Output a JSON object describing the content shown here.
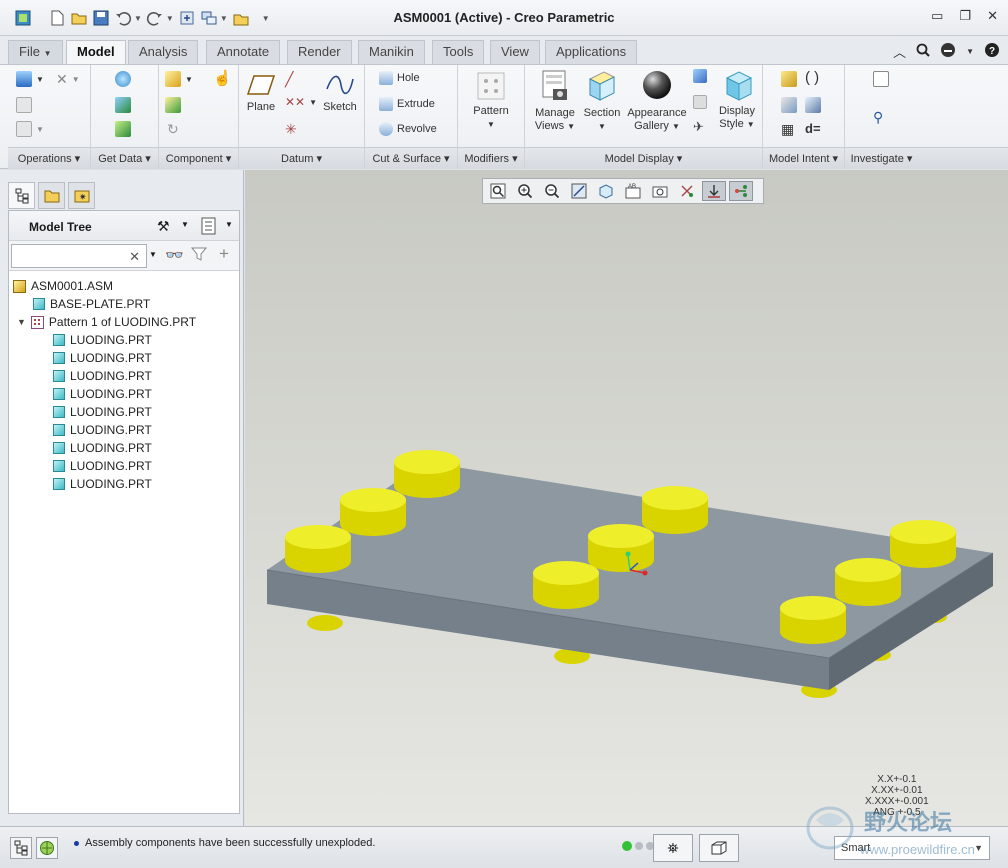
{
  "app": {
    "title": "ASM0001 (Active) - Creo Parametric"
  },
  "tabs": [
    "File",
    "Model",
    "Analysis",
    "Annotate",
    "Render",
    "Manikin",
    "Tools",
    "View",
    "Applications"
  ],
  "active_tab": "Model",
  "ribbon": {
    "groups": {
      "operations": "Operations",
      "get_data": "Get Data",
      "component": "Component",
      "datum": "Datum",
      "cut_surface": "Cut & Surface",
      "modifiers": "Modifiers",
      "model_display": "Model Display",
      "model_intent": "Model Intent",
      "investigate": "Investigate"
    },
    "buttons": {
      "plane": "Plane",
      "sketch": "Sketch",
      "hole": "Hole",
      "extrude": "Extrude",
      "revolve": "Revolve",
      "pattern": "Pattern",
      "manage_views_1": "Manage",
      "manage_views_2": "Views",
      "section": "Section",
      "appearance_1": "Appearance",
      "appearance_2": "Gallery",
      "display_style_1": "Display",
      "display_style_2": "Style"
    }
  },
  "model_tree": {
    "header": "Model Tree",
    "search_placeholder": "",
    "root": "ASM0001.ASM",
    "base": "BASE-PLATE.PRT",
    "pattern": "Pattern 1 of LUODING.PRT",
    "children": [
      "LUODING.PRT",
      "LUODING.PRT",
      "LUODING.PRT",
      "LUODING.PRT",
      "LUODING.PRT",
      "LUODING.PRT",
      "LUODING.PRT",
      "LUODING.PRT",
      "LUODING.PRT"
    ]
  },
  "viewport": {
    "tolerances": [
      "X.X+-0.1",
      "X.XX+-0.01",
      "X.XXX+-0.001",
      "ANG +-0.5"
    ],
    "plate_color": "#8a949c",
    "cylinder_color": "#e6e600"
  },
  "status": {
    "message": "Assembly components have been successfully unexploded.",
    "selection_filter": "Smart"
  },
  "watermark": {
    "cn": "野火论坛",
    "url": "www.proewildfire.cn"
  }
}
